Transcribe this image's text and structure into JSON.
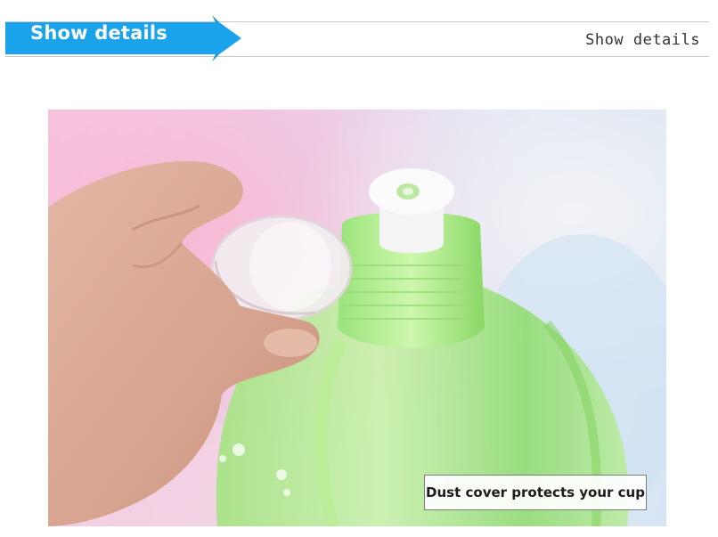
{
  "header": {
    "title": "Show details",
    "right_label": "Show details",
    "accent_color": "#1aa3ea"
  },
  "photo": {
    "subject": "product-photo",
    "caption": "Dust cover protects your cup"
  }
}
